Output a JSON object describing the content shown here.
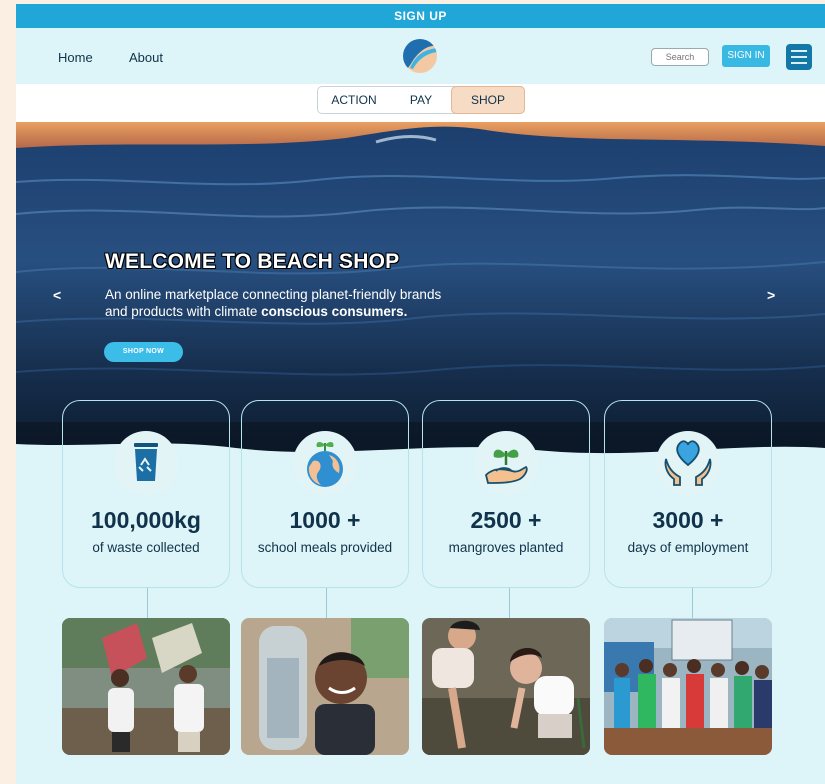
{
  "top_bar": {
    "signup_label": "SIGN UP"
  },
  "nav": {
    "home": "Home",
    "about": "About",
    "search_placeholder": "Search",
    "signin_label": "SIGN IN"
  },
  "tabs": [
    {
      "label": "ACTION"
    },
    {
      "label": "PAY"
    },
    {
      "label": "SHOP",
      "active": true
    }
  ],
  "hero": {
    "title": "WELCOME TO BEACH SHOP",
    "subtitle_line1": "An online marketplace connecting planet-friendly brands",
    "subtitle_line2_plain": "and products with climate ",
    "subtitle_line2_bold": "conscious consumers.",
    "cta_label": "SHOP NOW",
    "prev_arrow": "<",
    "next_arrow": ">"
  },
  "stats": [
    {
      "value": "100,000kg",
      "label": "of waste collected",
      "icon": "recycle-bin-icon"
    },
    {
      "value": "1000 +",
      "label": "school meals provided",
      "icon": "globe-plant-icon"
    },
    {
      "value": "2500 +",
      "label": "mangroves planted",
      "icon": "hand-seedling-icon"
    },
    {
      "value": "3000 +",
      "label": "days of employment",
      "icon": "hands-heart-icon"
    }
  ],
  "photos": [
    {
      "name": "photo-waste-collection"
    },
    {
      "name": "photo-school-child"
    },
    {
      "name": "photo-mangrove-planting"
    },
    {
      "name": "photo-community-group"
    }
  ],
  "colors": {
    "accent": "#21a6d8",
    "dark_text": "#10324a",
    "page_bg": "#ddf5f9",
    "outer_bg": "#fbeee2",
    "shop_tab": "#f6dcc5"
  }
}
